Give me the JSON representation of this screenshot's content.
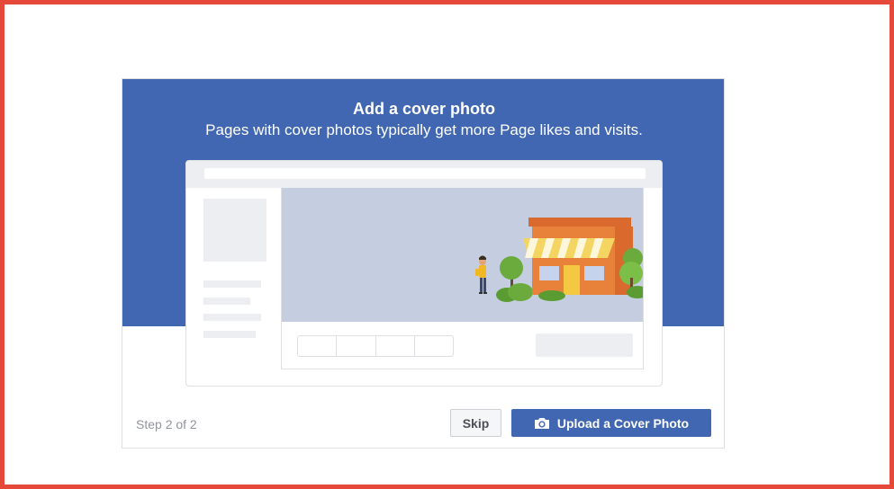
{
  "dialog": {
    "title": "Add a cover photo",
    "subtitle": "Pages with cover photos typically get more Page likes and visits.",
    "step_text": "Step 2 of 2",
    "skip_label": "Skip",
    "upload_label": "Upload a Cover Photo",
    "upload_icon": "camera-icon"
  },
  "colors": {
    "brand": "#4267b2",
    "frame_outline": "#e4493a",
    "cover_bg": "#c5cde0",
    "store_orange": "#e8813a",
    "tree_green": "#6bab3e"
  }
}
